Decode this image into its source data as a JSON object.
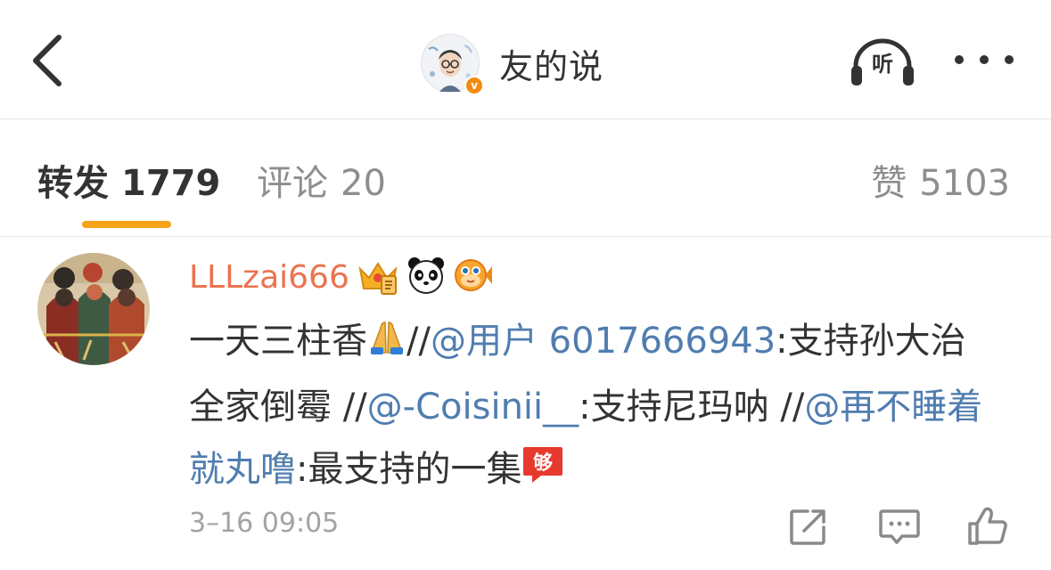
{
  "nav": {
    "back_icon": "chevron-left-icon",
    "title": "友的说",
    "avatar_badge": "v",
    "listen_label": "听",
    "more_icon": "more-dots-icon"
  },
  "tabs": {
    "repost_label": "转发",
    "repost_count": "1779",
    "comment_label": "评论",
    "comment_count": "20",
    "like_label": "赞",
    "like_count": "5103",
    "active": "repost",
    "active_color": "#f7a31a"
  },
  "repost": {
    "username": "LLLzai666",
    "username_color": "#eb7350",
    "badges": [
      "crown-icon",
      "panda-icon",
      "pufferfish-icon"
    ],
    "text_1": "一天三柱香",
    "sep_1": "//",
    "mention_1": "@用户 6017666943",
    "text_2": ":支持孙大治全家倒霉",
    "sep_2": " //",
    "mention_2": "@-Coisinii__",
    "text_3": ":支持尼玛呐",
    "sep_3": " //",
    "mention_3": "@再不睡着就丸噜",
    "text_4": ":最支持的一集",
    "mention_color": "#507daf",
    "emojis": [
      "pray-emoji",
      "gou-emoji"
    ],
    "timestamp": "3–16 09:05",
    "actions": [
      "repost-icon",
      "comment-icon",
      "like-icon"
    ]
  }
}
